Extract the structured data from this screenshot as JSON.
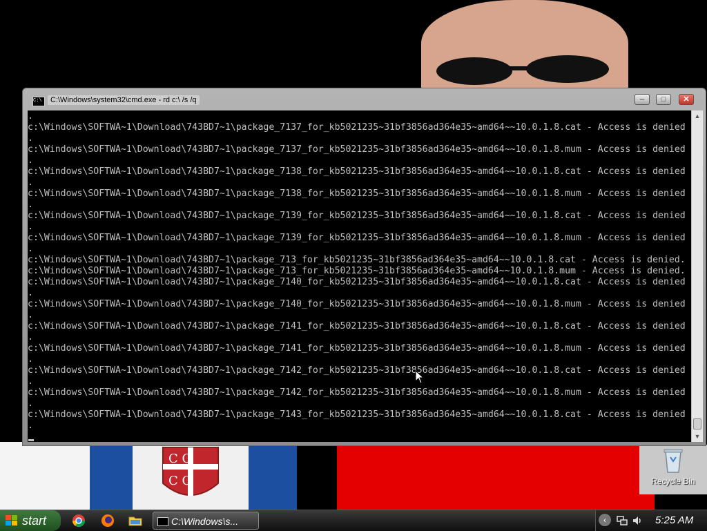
{
  "window": {
    "title": "C:\\Windows\\system32\\cmd.exe - rd  c:\\ /s /q",
    "min_glyph": "–",
    "max_glyph": "□",
    "close_glyph": "✕"
  },
  "console": {
    "lines": [
      ".",
      "c:\\Windows\\SOFTWA~1\\Download\\743BD7~1\\package_7137_for_kb5021235~31bf3856ad364e35~amd64~~10.0.1.8.cat - Access is denied",
      ".",
      "c:\\Windows\\SOFTWA~1\\Download\\743BD7~1\\package_7137_for_kb5021235~31bf3856ad364e35~amd64~~10.0.1.8.mum - Access is denied",
      ".",
      "c:\\Windows\\SOFTWA~1\\Download\\743BD7~1\\package_7138_for_kb5021235~31bf3856ad364e35~amd64~~10.0.1.8.cat - Access is denied",
      ".",
      "c:\\Windows\\SOFTWA~1\\Download\\743BD7~1\\package_7138_for_kb5021235~31bf3856ad364e35~amd64~~10.0.1.8.mum - Access is denied",
      ".",
      "c:\\Windows\\SOFTWA~1\\Download\\743BD7~1\\package_7139_for_kb5021235~31bf3856ad364e35~amd64~~10.0.1.8.cat - Access is denied",
      ".",
      "c:\\Windows\\SOFTWA~1\\Download\\743BD7~1\\package_7139_for_kb5021235~31bf3856ad364e35~amd64~~10.0.1.8.mum - Access is denied",
      ".",
      "c:\\Windows\\SOFTWA~1\\Download\\743BD7~1\\package_713_for_kb5021235~31bf3856ad364e35~amd64~~10.0.1.8.cat - Access is denied.",
      "c:\\Windows\\SOFTWA~1\\Download\\743BD7~1\\package_713_for_kb5021235~31bf3856ad364e35~amd64~~10.0.1.8.mum - Access is denied.",
      "c:\\Windows\\SOFTWA~1\\Download\\743BD7~1\\package_7140_for_kb5021235~31bf3856ad364e35~amd64~~10.0.1.8.cat - Access is denied",
      ".",
      "c:\\Windows\\SOFTWA~1\\Download\\743BD7~1\\package_7140_for_kb5021235~31bf3856ad364e35~amd64~~10.0.1.8.mum - Access is denied",
      ".",
      "c:\\Windows\\SOFTWA~1\\Download\\743BD7~1\\package_7141_for_kb5021235~31bf3856ad364e35~amd64~~10.0.1.8.cat - Access is denied",
      ".",
      "c:\\Windows\\SOFTWA~1\\Download\\743BD7~1\\package_7141_for_kb5021235~31bf3856ad364e35~amd64~~10.0.1.8.mum - Access is denied",
      ".",
      "c:\\Windows\\SOFTWA~1\\Download\\743BD7~1\\package_7142_for_kb5021235~31bf3856ad364e35~amd64~~10.0.1.8.cat - Access is denied",
      ".",
      "c:\\Windows\\SOFTWA~1\\Download\\743BD7~1\\package_7142_for_kb5021235~31bf3856ad364e35~amd64~~10.0.1.8.mum - Access is denied",
      ".",
      "c:\\Windows\\SOFTWA~1\\Download\\743BD7~1\\package_7143_for_kb5021235~31bf3856ad364e35~amd64~~10.0.1.8.cat - Access is denied",
      "."
    ]
  },
  "desktop": {
    "recycle_bin_label": "Recycle Bin"
  },
  "taskbar": {
    "start_label": "start",
    "task_label": "C:\\Windows\\s...",
    "clock": "5:25 AM",
    "quick_launch": [
      "chrome-icon",
      "firefox-icon",
      "folder-icon"
    ],
    "tray_chevron": "‹"
  },
  "colors": {
    "console_text": "#c0c0c0",
    "console_bg": "#000000",
    "close_button": "#c0362a",
    "start_button": "#2f6a2f"
  }
}
